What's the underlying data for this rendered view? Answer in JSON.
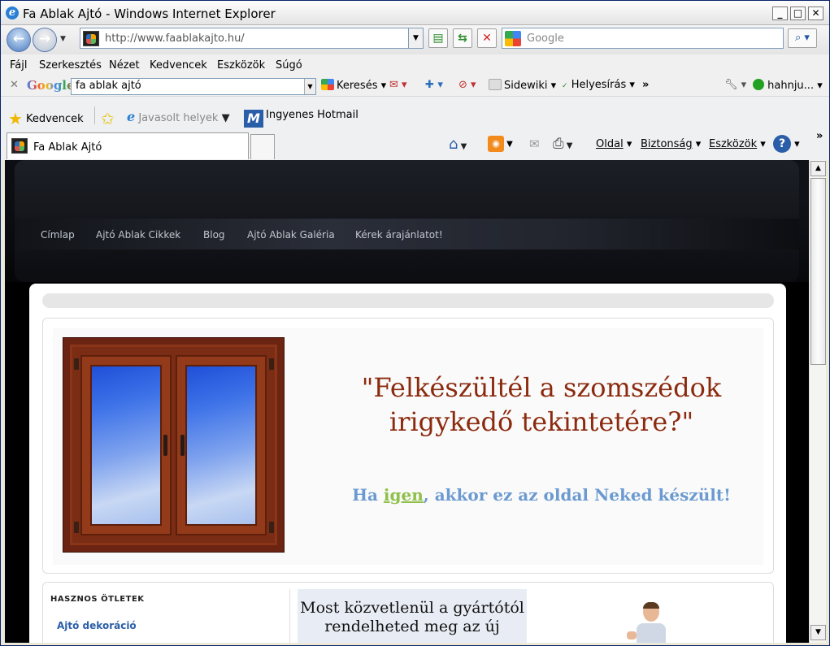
{
  "window": {
    "title": "Fa Ablak Ajtó - Windows Internet Explorer"
  },
  "address": {
    "url": "http://www.faablakajto.hu/"
  },
  "search": {
    "placeholder": "Google"
  },
  "menu": [
    "Fájl",
    "Szerkesztés",
    "Nézet",
    "Kedvencek",
    "Eszközök",
    "Súgó"
  ],
  "google_toolbar": {
    "logo": "Google",
    "query": "fa ablak ajtó",
    "search_label": "Keresés",
    "sidewiki_label": "Sidewiki",
    "spell_label": "Helyesírás",
    "user_label": "hahnju..."
  },
  "favorites": {
    "favorites_label": "Kedvencek",
    "suggested_label": "Javasolt helyek",
    "hotmail_label": "Ingyenes Hotmail"
  },
  "tab": {
    "title": "Fa Ablak Ajtó"
  },
  "commands": {
    "page_label": "Oldal",
    "safety_label": "Biztonság",
    "tools_label": "Eszközök"
  },
  "site": {
    "nav": [
      "Címlap",
      "Ajtó Ablak Cikkek",
      "Blog",
      "Ajtó Ablak Galéria",
      "Kérek árajánlatot!"
    ],
    "hero_quote_line1": "\"Felkészültél a szomszédok",
    "hero_quote_line2": "irigykedő tekintetére?\"",
    "hero_sub_pre": "Ha ",
    "hero_sub_yes": "igen",
    "hero_sub_post": ", akkor ez az oldal Neked készült!",
    "sidebar_heading": "HASZNOS ÖTLETEK",
    "sidebar_link": "Ajtó dekoráció",
    "promo_line1": "Most közvetlenül a gyártótól",
    "promo_line2": "rendelheted meg az új"
  },
  "colors": {
    "title_quote": "#8b2a0e",
    "subtitle": "#6b9ad0",
    "highlight": "#8fc04a",
    "link": "#2a5ea8"
  }
}
